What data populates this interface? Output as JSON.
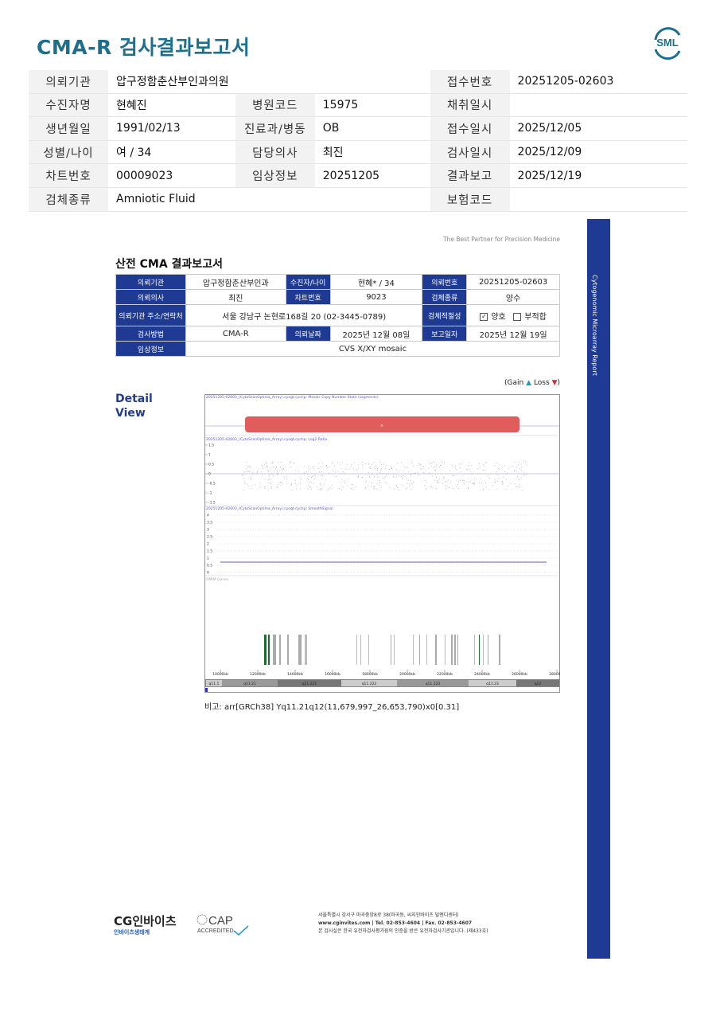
{
  "title": "CMA-R 검사결과보고서",
  "logo_text": "SML",
  "header_rows": [
    [
      {
        "label": "의뢰기관",
        "value": "압구정함춘산부인과의원",
        "span": 3
      },
      {
        "label": "접수번호",
        "value": "20251205-02603"
      }
    ],
    [
      {
        "label": "수진자명",
        "value": "현혜진"
      },
      {
        "label": "병원코드",
        "value": "15975"
      },
      {
        "label": "채취일시",
        "value": ""
      }
    ],
    [
      {
        "label": "생년월일",
        "value": "1991/02/13"
      },
      {
        "label": "진료과/병동",
        "value": "OB"
      },
      {
        "label": "접수일시",
        "value": "2025/12/05"
      }
    ],
    [
      {
        "label": "성별/나이",
        "value": "여 / 34"
      },
      {
        "label": "담당의사",
        "value": "최진"
      },
      {
        "label": "검사일시",
        "value": "2025/12/09"
      }
    ],
    [
      {
        "label": "차트번호",
        "value": "00009023"
      },
      {
        "label": "임상정보",
        "value": "20251205"
      },
      {
        "label": "결과보고",
        "value": "2025/12/19"
      }
    ],
    [
      {
        "label": "검체종류",
        "value": "Amniotic Fluid",
        "span": 3
      },
      {
        "label": "보험코드",
        "value": ""
      }
    ]
  ],
  "report": {
    "tagline": "The Best Partner for Precision Medicine",
    "title": "산전 CMA 결과보고서",
    "rows": [
      [
        "의뢰기관",
        "압구정함춘산부인과",
        "수진자/나이",
        "현혜* / 34",
        "의뢰번호",
        "20251205-02603"
      ],
      [
        "의뢰의사",
        "최진",
        "차트번호",
        "9023",
        "검체종류",
        "양수"
      ],
      [
        "의뢰기관 주소/연락처",
        "서울 강남구 논현로168길 20 (02-3445-0789)",
        "검체적절성",
        "양호",
        "부적합"
      ],
      [
        "검사방법",
        "CMA-R",
        "의뢰날짜",
        "2025년 12월 08일",
        "보고일자",
        "2025년 12월 19일"
      ],
      [
        "임상정보",
        "CVS X/XY mosaic"
      ]
    ],
    "legend": {
      "prefix": "(Gain",
      "gain_arrow": "▲",
      "mid": "Loss",
      "loss_arrow": "▼",
      "suffix": ")"
    },
    "detail_line1": "Detail",
    "detail_line2": "View",
    "panel1_label": "20251205-02603_(CytoScanOptima_Array).cyogt.cychp: Mosaic Copy Number State (segments)",
    "panel2_label": "20251205-02603_(CytoScanOptima_Array).cyogt.cychp: Log2 Ratio",
    "panel3_label": "20251205-02603_(CytoScanOptima_Array).cyogt.cychp: SmoothSignal",
    "panel2_ticks": [
      "1.5",
      "1",
      "0.5",
      "0",
      "-0.5",
      "-1",
      "-1.5"
    ],
    "panel3_ticks": [
      "4",
      "3.5",
      "3",
      "2.5",
      "2",
      "1.5",
      "1",
      "0.5",
      "0"
    ],
    "genes_label": "OMIM Genes",
    "x_ticks": [
      "10000kb",
      "12000kb",
      "14000kb",
      "16000kb",
      "18000kb",
      "20000kb",
      "22000kb",
      "24000kb",
      "26000kb",
      "28000kb"
    ],
    "bands": [
      "q11.1",
      "q11.21",
      "q11.221",
      "q11.222",
      "q11.223",
      "q11.23",
      "q12"
    ],
    "note": "비고: arr[GRCh38] Yq11.21q12(11,679,997_26,653,790)x0[0.31]",
    "side_text": "Cytogenomic Microarray Report"
  },
  "footer": {
    "brand": "CG인바이츠",
    "brand_sub": "인바이츠생태계",
    "cap_text": "CAP",
    "cap_sub": "ACCREDITED",
    "address": "서울특별시 강서구 마곡중앙8로 38(마곡동, 씨지인바이츠 덜멘디센터)",
    "web": "www.cginvites.com | Tel. 02-853-4604 | Fax. 02-853-4607",
    "cert": "본 검사실은 한국 유전자검사평가원의 인증을 받은 유전자검사기관입니다. (제433호)"
  }
}
